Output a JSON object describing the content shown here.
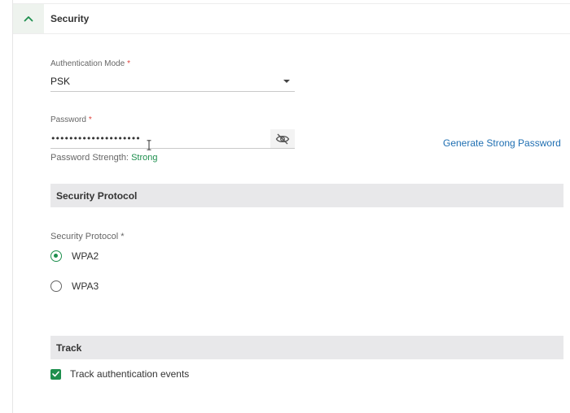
{
  "security": {
    "title": "Security",
    "collapse_icon": "chevron-up-icon"
  },
  "auth_mode": {
    "label": "Authentication Mode",
    "required_mark": "*",
    "value": "PSK",
    "dropdown_icon": "caret-down-icon"
  },
  "password": {
    "label": "Password",
    "required_mark": "*",
    "value": "••••••••••••••••••••",
    "visibility_icon": "eye-slash-icon",
    "generate_label": "Generate Strong Password",
    "strength_label": "Password Strength:",
    "strength_value": "Strong",
    "strength_color": "#1e8f4e"
  },
  "security_protocol_section": {
    "title": "Security Protocol",
    "field_label": "Security Protocol *",
    "options": [
      {
        "label": "WPA2",
        "selected": true
      },
      {
        "label": "WPA3",
        "selected": false
      }
    ]
  },
  "track_section": {
    "title": "Track",
    "checkbox_label": "Track authentication events",
    "checked": true
  },
  "colors": {
    "accent_green": "#1e8f4e",
    "link_blue": "#1f6fb2",
    "required_red": "#e0413b",
    "subheader_bg": "#e8e8ea"
  }
}
